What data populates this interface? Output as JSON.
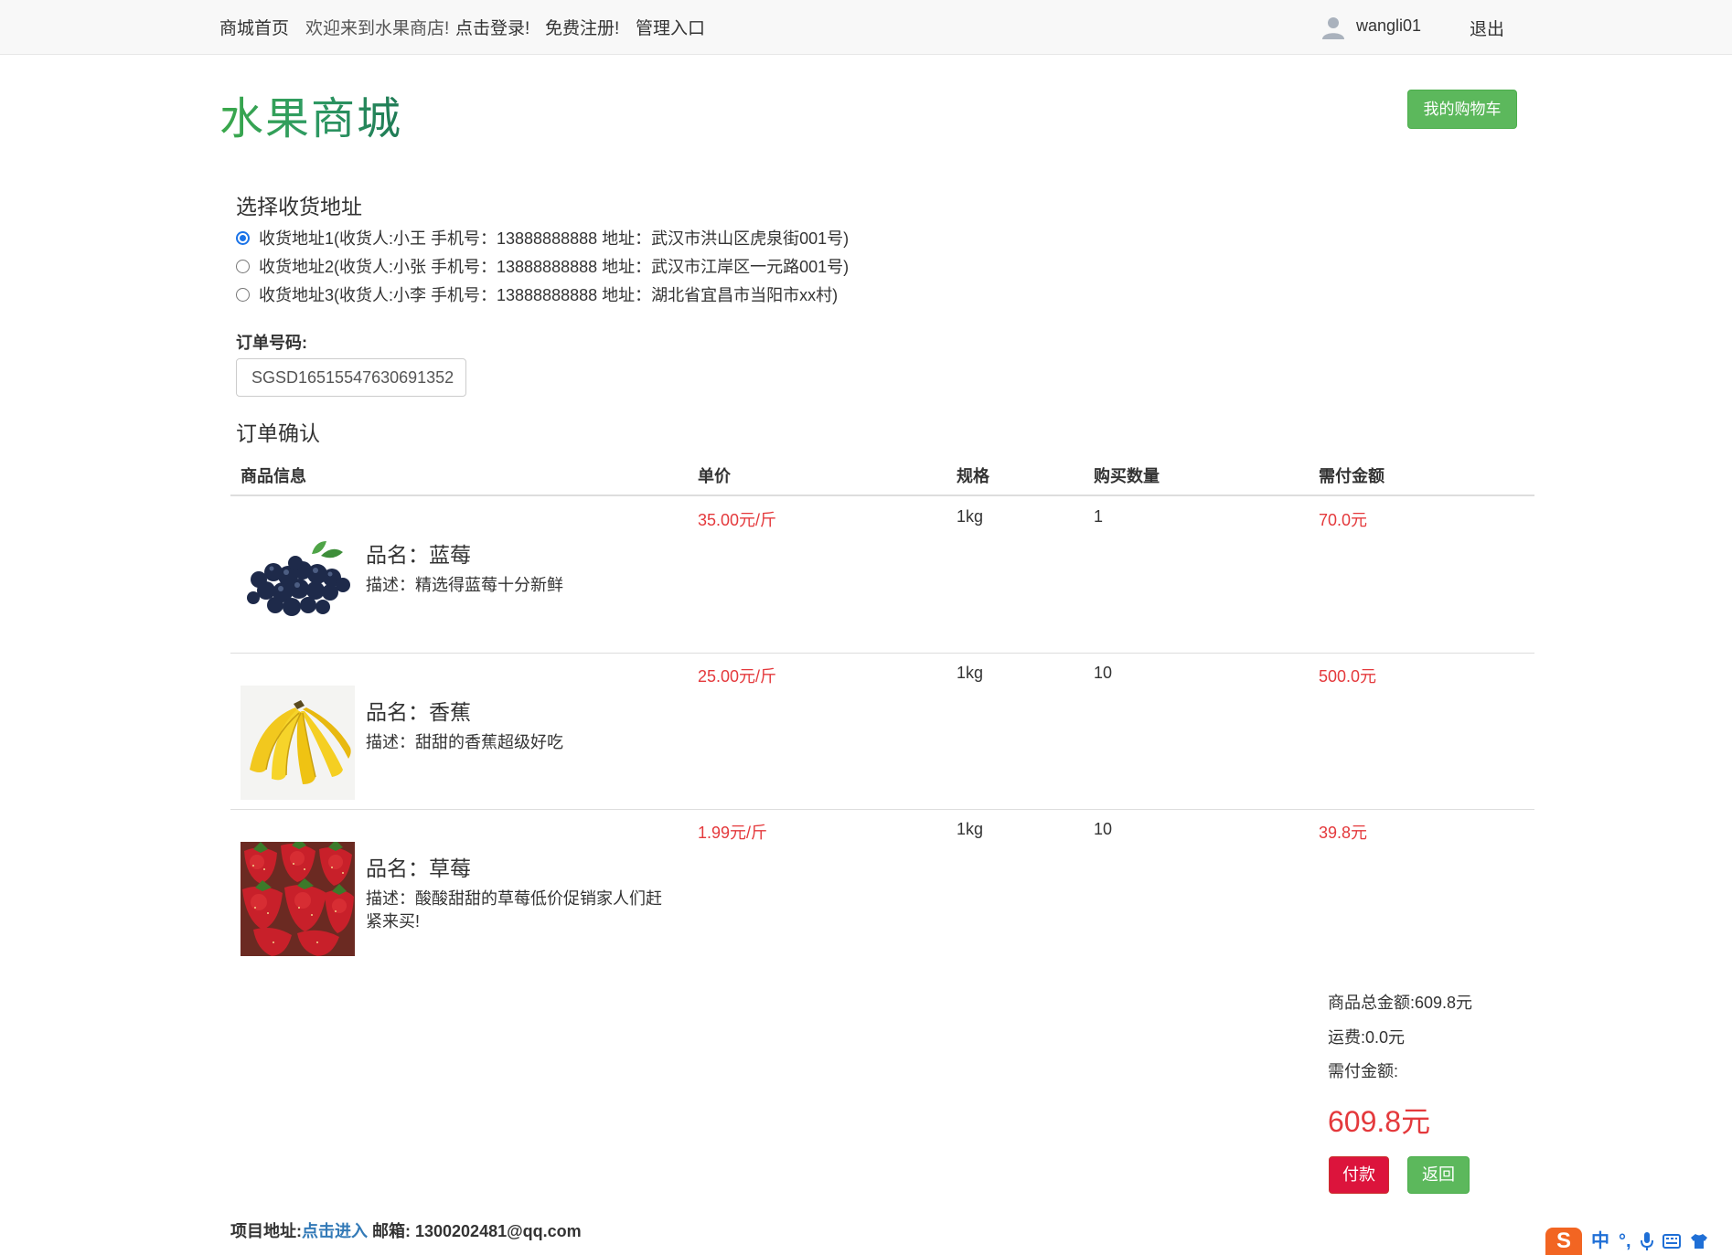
{
  "nav": {
    "home": "商城首页",
    "welcome": "欢迎来到水果商店!",
    "login": "点击登录!",
    "register": "免费注册!",
    "admin": "管理入口",
    "username": "wangli01",
    "logout": "退出"
  },
  "header": {
    "logo": "水果商城",
    "cart_button": "我的购物车"
  },
  "address": {
    "title": "选择收货地址",
    "options": [
      {
        "label": "收货地址1(收货人:小王 手机号：13888888888 地址：武汉市洪山区虎泉街001号)",
        "selected": true
      },
      {
        "label": "收货地址2(收货人:小张 手机号：13888888888 地址：武汉市江岸区一元路001号)",
        "selected": false
      },
      {
        "label": "收货地址3(收货人:小李 手机号：13888888888 地址：湖北省宜昌市当阳市xx村)",
        "selected": false
      }
    ]
  },
  "order": {
    "number_label": "订单号码:",
    "number_value": "SGSD16515547630691352",
    "confirm_title": "订单确认"
  },
  "table": {
    "headers": [
      "商品信息",
      "单价",
      "规格",
      "购买数量",
      "需付金额"
    ],
    "rows": [
      {
        "name": "品名：蓝莓",
        "desc": "描述：精选得蓝莓十分新鲜",
        "price": "35.00元/斤",
        "spec": "1kg",
        "qty": "1",
        "amount": "70.0元",
        "image": "blueberry-image"
      },
      {
        "name": "品名：香蕉",
        "desc": "描述：甜甜的香蕉超级好吃",
        "price": "25.00元/斤",
        "spec": "1kg",
        "qty": "10",
        "amount": "500.0元",
        "image": "banana-image"
      },
      {
        "name": "品名：草莓",
        "desc": "描述：酸酸甜甜的草莓低价促销家人们赶紧来买!",
        "price": "1.99元/斤",
        "spec": "1kg",
        "qty": "10",
        "amount": "39.8元",
        "image": "strawberry-image"
      }
    ]
  },
  "summary": {
    "goods_total": "商品总金额:609.8元",
    "shipping": "运费:0.0元",
    "payable_label": "需付金额:",
    "payable_value": "609.8元",
    "pay_button": "付款",
    "back_button": "返回"
  },
  "footer": {
    "project_label": "项目地址:",
    "project_link": "点击进入",
    "email": " 邮箱: 1300202481@qq.com"
  },
  "ime": {
    "logo": "S",
    "items": [
      "中",
      "°,",
      "mic-icon",
      "keyboard-icon",
      "shirt-icon"
    ]
  },
  "colors": {
    "accent_green": "#5cb85c",
    "price_red": "#e4393c",
    "pay_red": "#dc143c",
    "link_blue": "#337ab7"
  }
}
